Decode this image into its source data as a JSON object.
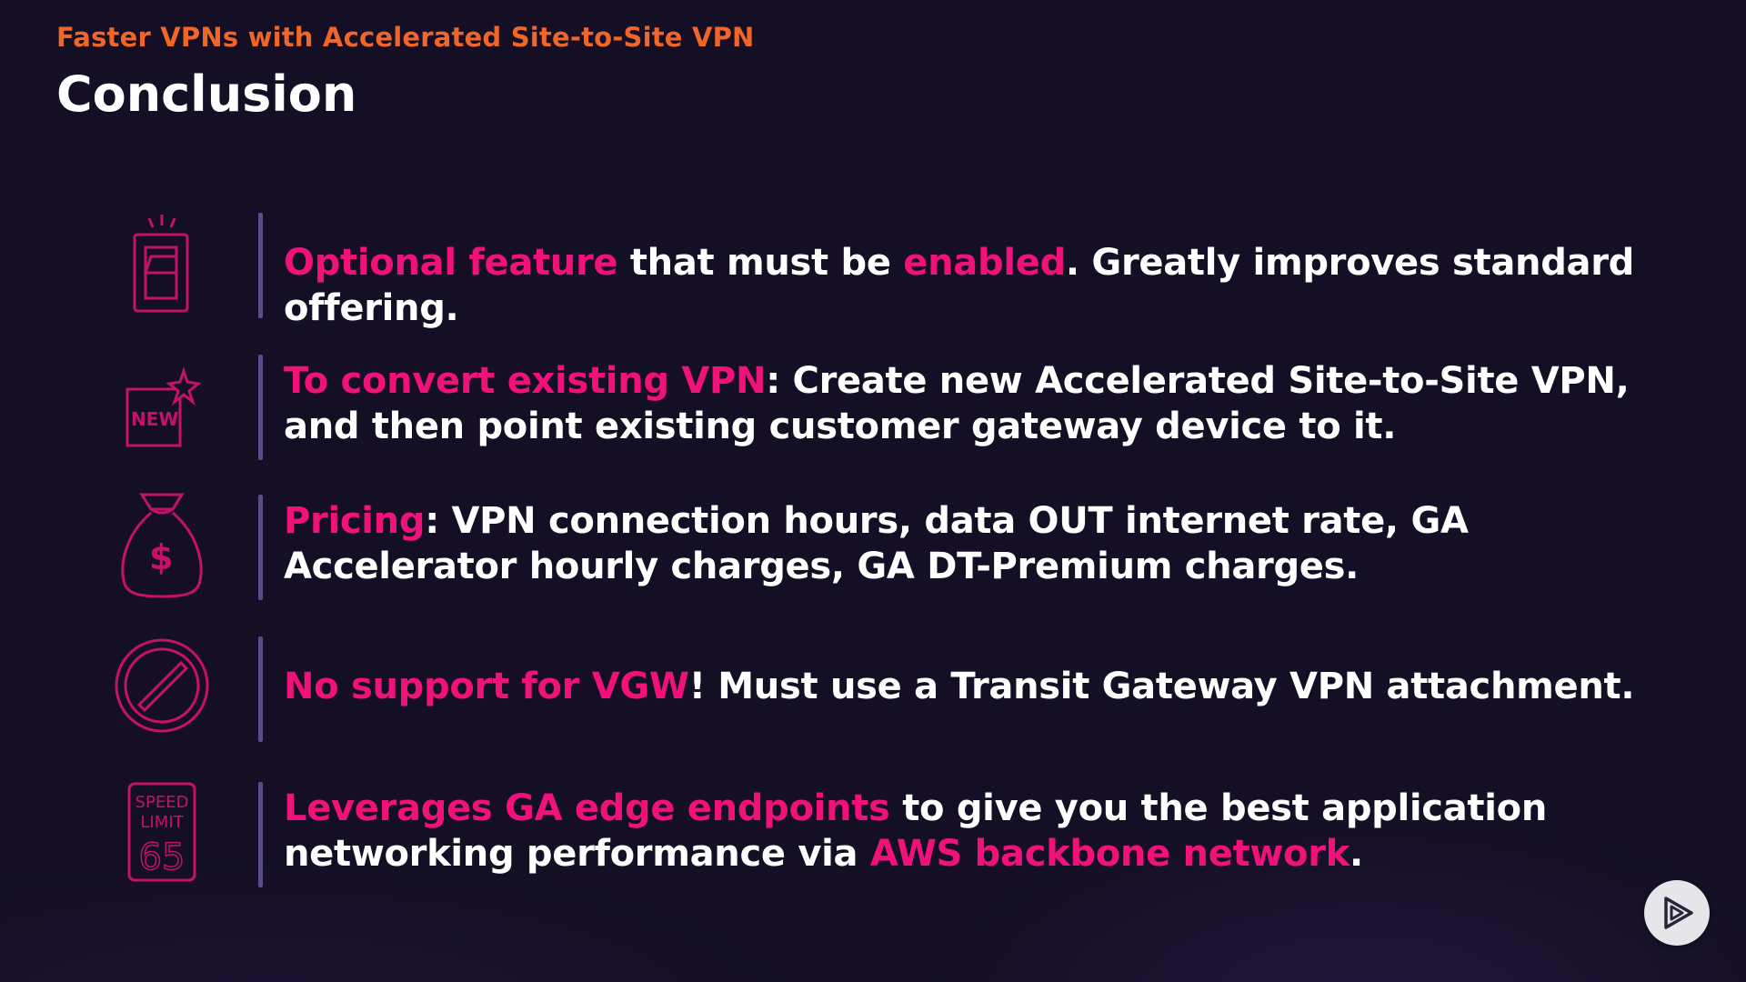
{
  "header": {
    "subtitle": "Faster VPNs with Accelerated Site-to-Site VPN",
    "title": "Conclusion"
  },
  "points": [
    {
      "icon": "toggle-switch-icon",
      "parts": [
        {
          "text": "Optional feature",
          "hl": true
        },
        {
          "text": " that must be ",
          "hl": false
        },
        {
          "text": "enabled",
          "hl": true
        },
        {
          "text": ". Greatly improves standard offering.",
          "hl": false
        }
      ]
    },
    {
      "icon": "new-badge-icon",
      "icon_text": "NEW",
      "parts": [
        {
          "text": "To convert existing VPN",
          "hl": true
        },
        {
          "text": ": Create new Accelerated Site-to-Site VPN, and then point existing customer gateway device to it.",
          "hl": false
        }
      ]
    },
    {
      "icon": "money-bag-icon",
      "icon_text": "$",
      "parts": [
        {
          "text": "Pricing",
          "hl": true
        },
        {
          "text": ": VPN connection hours, data OUT internet rate, GA Accelerator hourly charges, GA DT-Premium charges.",
          "hl": false
        }
      ]
    },
    {
      "icon": "prohibited-icon",
      "parts": [
        {
          "text": "No support for VGW",
          "hl": true
        },
        {
          "text": "! Must use a Transit Gateway VPN attachment.",
          "hl": false
        }
      ]
    },
    {
      "icon": "speed-limit-sign-icon",
      "icon_text_lines": [
        "SPEED",
        "LIMIT",
        "65"
      ],
      "parts": [
        {
          "text": "Leverages GA edge endpoints",
          "hl": true
        },
        {
          "text": " to give you the best application networking performance via ",
          "hl": false
        },
        {
          "text": "AWS backbone network",
          "hl": true
        },
        {
          "text": ".",
          "hl": false
        }
      ]
    }
  ],
  "player": {
    "icon": "play-logo-icon"
  },
  "colors": {
    "background": "#140f24",
    "accent_orange": "#f0662a",
    "accent_pink": "#f0127a",
    "bar": "#5a4d87",
    "text": "#ffffff"
  }
}
